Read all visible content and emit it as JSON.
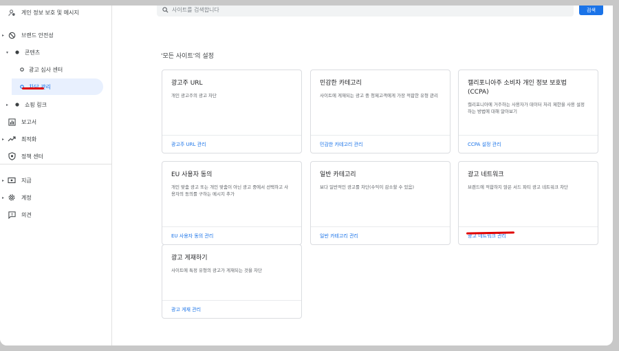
{
  "sidebar": {
    "items": [
      {
        "label": "게인 정보 보호 및 메시지",
        "icon": "person-shield-icon"
      },
      {
        "label": "브랜드 안전성",
        "icon": "block-icon"
      },
      {
        "label": "콘텐츠",
        "icon": "dot-icon"
      },
      {
        "label": "광고 심사 센터",
        "icon": "circle-icon"
      },
      {
        "label": "차단 관리",
        "icon": "circle-icon"
      },
      {
        "label": "쇼핑 링크",
        "icon": "dot-icon"
      },
      {
        "label": "보고서",
        "icon": "bar-chart-icon"
      },
      {
        "label": "최적화",
        "icon": "trending-up-icon"
      },
      {
        "label": "정책 센터",
        "icon": "shield-icon"
      },
      {
        "label": "지급",
        "icon": "payments-icon"
      },
      {
        "label": "계정",
        "icon": "gear-icon"
      },
      {
        "label": "의견",
        "icon": "feedback-icon"
      }
    ]
  },
  "search": {
    "placeholder": "사이트를 검색합니다",
    "button": "검색"
  },
  "section_title": "'모든 사이트'의 설정",
  "cards": [
    {
      "title": "광고주 URL",
      "desc": "개인 광고주의 광고 차단",
      "link": "광고주 URL 관리"
    },
    {
      "title": "민감한 카테고리",
      "desc": "사이트에 게재되는 광고 중 청제고객에게 가장 적합한 유형 관리",
      "link": "민감한 카테고리 관리"
    },
    {
      "title": "캘리포니아주 소비자 개인 정보 보호법 (CCPA)",
      "desc": "캘리포니아에 거주하는 사용자가 데이터 처리 제한을 사용 설정하는 방법에 대해 알아보기",
      "link": "CCPA 설정 관리"
    },
    {
      "title": "EU 사용자 동의",
      "desc": "개인 맞춤 광고 또는 개인 맞춤이 아닌 광고 중에서 선택하고 사용자의 동의를 구하는 메시지 추가",
      "link": "EU 사용자 동의 관리"
    },
    {
      "title": "일반 카테고리",
      "desc": "보다 일반적인 광고를 차단(수익이 감소할 수 있음)",
      "link": "일반 카테고리 관리"
    },
    {
      "title": "광고 네트워크",
      "desc": "브랜드에 적합하지 않은 서드 파티 광고 네트워크 차단",
      "link": "광고 네트워크 관리"
    },
    {
      "title": "광고 게재하기",
      "desc": "사이트에 특정 유형의 광고가 게재되는 것을 차단",
      "link": "광고 게재 관리"
    }
  ],
  "colors": {
    "accent": "#1a73e8",
    "annotation": "#e00000",
    "active_bg": "#e8f0fe"
  }
}
